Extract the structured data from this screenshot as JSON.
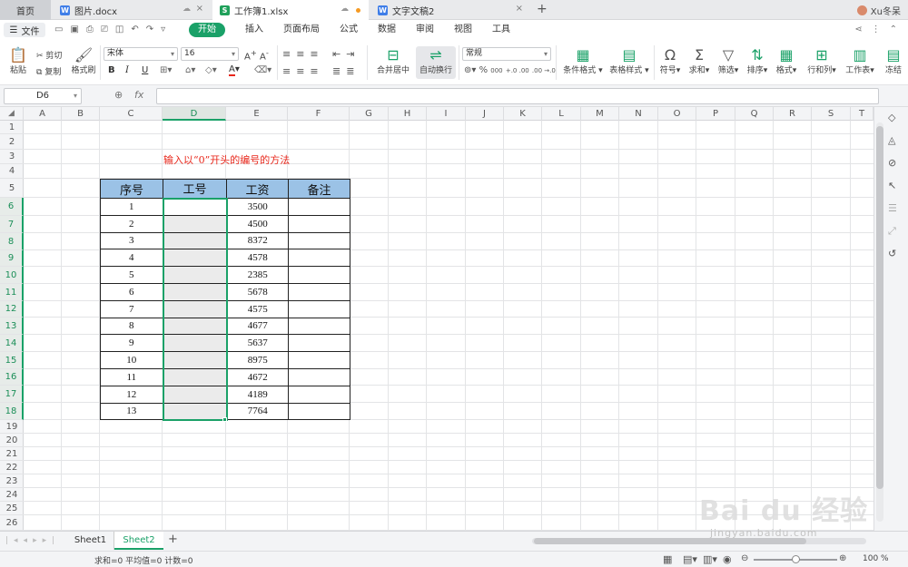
{
  "tabs": {
    "home": "首页",
    "doc1": "图片.docx",
    "xls": "工作簿1.xlsx",
    "doc2": "文字文稿2",
    "user": "Xu冬呆"
  },
  "menu": {
    "file": "文件",
    "items": [
      "开始",
      "插入",
      "页面布局",
      "公式",
      "数据",
      "审阅",
      "视图",
      "工具"
    ]
  },
  "ribbon": {
    "paste": "粘贴",
    "cut": "剪切",
    "copy": "复制",
    "format_painter": "格式刷",
    "font_name": "宋体",
    "font_size": "16",
    "merge_center": "合并居中",
    "wrap_text": "自动换行",
    "number_format": "常规",
    "conditional_format": "条件格式",
    "table_style": "表格样式",
    "symbol": "符号",
    "sum": "求和",
    "filter": "筛选",
    "sort": "排序",
    "format": "格式",
    "row_col": "行和列",
    "worksheet": "工作表",
    "freeze": "冻结"
  },
  "formula_bar": {
    "name_box": "D6",
    "fx": "fx"
  },
  "grid": {
    "columns": [
      "A",
      "B",
      "C",
      "D",
      "E",
      "F",
      "G",
      "H",
      "I",
      "J",
      "K",
      "L",
      "M",
      "N",
      "O",
      "P",
      "Q",
      "R",
      "S",
      "T"
    ],
    "rows": [
      "1",
      "2",
      "3",
      "4",
      "5",
      "6",
      "7",
      "8",
      "9",
      "10",
      "11",
      "12",
      "13",
      "14",
      "15",
      "16",
      "17",
      "18",
      "19",
      "20",
      "21",
      "22",
      "23",
      "24",
      "25",
      "26",
      "27"
    ],
    "selected_column": "D",
    "note": "输入以“0”开头的编号的方法"
  },
  "table": {
    "headers": [
      "序号",
      "工号",
      "工资",
      "备注"
    ],
    "rows": [
      {
        "no": "1",
        "salary": "3500"
      },
      {
        "no": "2",
        "salary": "4500"
      },
      {
        "no": "3",
        "salary": "8372"
      },
      {
        "no": "4",
        "salary": "4578"
      },
      {
        "no": "5",
        "salary": "2385"
      },
      {
        "no": "6",
        "salary": "5678"
      },
      {
        "no": "7",
        "salary": "4575"
      },
      {
        "no": "8",
        "salary": "4677"
      },
      {
        "no": "9",
        "salary": "5637"
      },
      {
        "no": "10",
        "salary": "8975"
      },
      {
        "no": "11",
        "salary": "4672"
      },
      {
        "no": "12",
        "salary": "4189"
      },
      {
        "no": "13",
        "salary": "7764"
      }
    ]
  },
  "sheets": [
    "Sheet1",
    "Sheet2"
  ],
  "status": {
    "summary": "求和=0  平均值=0  计数=0",
    "zoom": "100 %"
  },
  "watermark": {
    "main": "Bai du 经验",
    "sub": "jingyan.baidu.com"
  },
  "colors": {
    "accent": "#1aa168",
    "header_fill": "#9bc2e6",
    "note_red": "#e8261a"
  }
}
